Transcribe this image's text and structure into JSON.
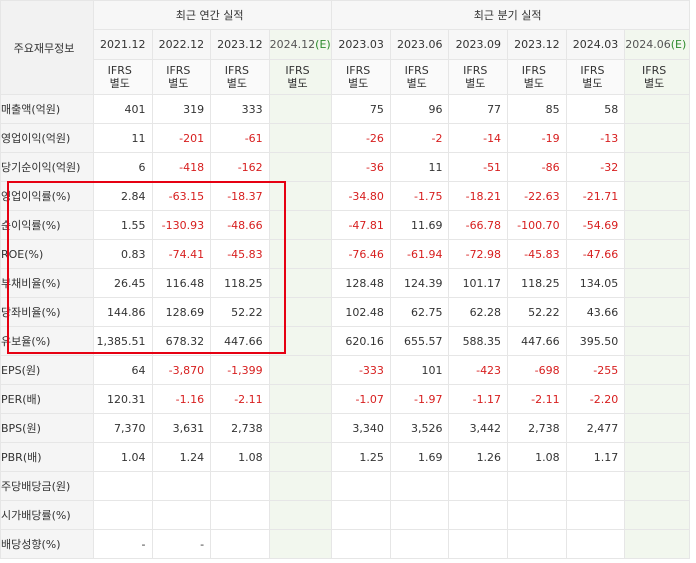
{
  "table": {
    "row_header_label": "주요재무정보",
    "groups": {
      "annual": "최근 연간 실적",
      "quarterly": "최근 분기 실적"
    },
    "annual_periods": [
      {
        "label": "2021.12"
      },
      {
        "label": "2022.12"
      },
      {
        "label": "2023.12"
      },
      {
        "label": "2024.12",
        "est_mark": "(E)"
      }
    ],
    "quarter_periods": [
      {
        "label": "2023.03"
      },
      {
        "label": "2023.06"
      },
      {
        "label": "2023.09"
      },
      {
        "label": "2023.12"
      },
      {
        "label": "2024.03"
      },
      {
        "label": "2024.06",
        "est_mark": "(E)"
      }
    ],
    "ifrs_line1": "IFRS",
    "ifrs_line2": "별도",
    "rows": [
      {
        "label": "매출액(억원)",
        "annual": [
          "401",
          "319",
          "333",
          ""
        ],
        "quarterly": [
          "75",
          "96",
          "77",
          "85",
          "58",
          ""
        ]
      },
      {
        "label": "영업이익(억원)",
        "annual": [
          "11",
          "-201",
          "-61",
          ""
        ],
        "quarterly": [
          "-26",
          "-2",
          "-14",
          "-19",
          "-13",
          ""
        ]
      },
      {
        "label": "당기순이익(억원)",
        "annual": [
          "6",
          "-418",
          "-162",
          ""
        ],
        "quarterly": [
          "-36",
          "11",
          "-51",
          "-86",
          "-32",
          ""
        ]
      },
      {
        "label": "영업이익률(%)",
        "annual": [
          "2.84",
          "-63.15",
          "-18.37",
          ""
        ],
        "quarterly": [
          "-34.80",
          "-1.75",
          "-18.21",
          "-22.63",
          "-21.71",
          ""
        ]
      },
      {
        "label": "순이익률(%)",
        "annual": [
          "1.55",
          "-130.93",
          "-48.66",
          ""
        ],
        "quarterly": [
          "-47.81",
          "11.69",
          "-66.78",
          "-100.70",
          "-54.69",
          ""
        ]
      },
      {
        "label": "ROE(%)",
        "annual": [
          "0.83",
          "-74.41",
          "-45.83",
          ""
        ],
        "quarterly": [
          "-76.46",
          "-61.94",
          "-72.98",
          "-45.83",
          "-47.66",
          ""
        ]
      },
      {
        "label": "부채비율(%)",
        "annual": [
          "26.45",
          "116.48",
          "118.25",
          ""
        ],
        "quarterly": [
          "128.48",
          "124.39",
          "101.17",
          "118.25",
          "134.05",
          ""
        ]
      },
      {
        "label": "당좌비율(%)",
        "annual": [
          "144.86",
          "128.69",
          "52.22",
          ""
        ],
        "quarterly": [
          "102.48",
          "62.75",
          "62.28",
          "52.22",
          "43.66",
          ""
        ]
      },
      {
        "label": "유보율(%)",
        "annual": [
          "1,385.51",
          "678.32",
          "447.66",
          ""
        ],
        "quarterly": [
          "620.16",
          "655.57",
          "588.35",
          "447.66",
          "395.50",
          ""
        ]
      },
      {
        "label": "EPS(원)",
        "annual": [
          "64",
          "-3,870",
          "-1,399",
          ""
        ],
        "quarterly": [
          "-333",
          "101",
          "-423",
          "-698",
          "-255",
          ""
        ]
      },
      {
        "label": "PER(배)",
        "annual": [
          "120.31",
          "-1.16",
          "-2.11",
          ""
        ],
        "quarterly": [
          "-1.07",
          "-1.97",
          "-1.17",
          "-2.11",
          "-2.20",
          ""
        ]
      },
      {
        "label": "BPS(원)",
        "annual": [
          "7,370",
          "3,631",
          "2,738",
          ""
        ],
        "quarterly": [
          "3,340",
          "3,526",
          "3,442",
          "2,738",
          "2,477",
          ""
        ]
      },
      {
        "label": "PBR(배)",
        "annual": [
          "1.04",
          "1.24",
          "1.08",
          ""
        ],
        "quarterly": [
          "1.25",
          "1.69",
          "1.26",
          "1.08",
          "1.17",
          ""
        ]
      },
      {
        "label": "주당배당금(원)",
        "annual": [
          "",
          "",
          "",
          ""
        ],
        "quarterly": [
          "",
          "",
          "",
          "",
          "",
          ""
        ]
      },
      {
        "label": "시가배당률(%)",
        "annual": [
          "",
          "",
          "",
          ""
        ],
        "quarterly": [
          "",
          "",
          "",
          "",
          "",
          ""
        ]
      },
      {
        "label": "배당성향(%)",
        "annual": [
          "-",
          "-",
          "",
          ""
        ],
        "quarterly": [
          "",
          "",
          "",
          "",
          "",
          ""
        ]
      }
    ]
  },
  "colors": {
    "negative": "#d71e1e",
    "ifrs": "#e0561b",
    "estimate_bg": "#f2f7ee",
    "highlight_box": "#e60012",
    "estimate_mark": "#2e8b2e"
  }
}
